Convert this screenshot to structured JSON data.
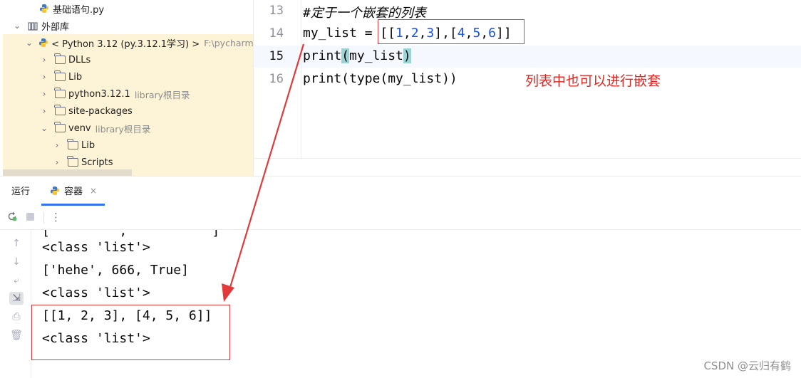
{
  "tree": {
    "items": [
      {
        "label": "基础语句.py",
        "hint": "",
        "path": "",
        "icon": "python-file-icon"
      },
      {
        "label": "外部库",
        "hint": "",
        "path": "",
        "icon": "library-icon"
      },
      {
        "label": "< Python 3.12 (py.3.12.1学习) >",
        "hint": "",
        "path": "F:\\pycharm-l",
        "icon": "python-sdk-icon"
      },
      {
        "label": "DLLs",
        "hint": "",
        "path": "",
        "icon": "folder-icon"
      },
      {
        "label": "Lib",
        "hint": "",
        "path": "",
        "icon": "folder-icon"
      },
      {
        "label": "python3.12.1",
        "hint": "library根目录",
        "path": "",
        "icon": "folder-icon"
      },
      {
        "label": "site-packages",
        "hint": "",
        "path": "",
        "icon": "folder-icon"
      },
      {
        "label": "venv",
        "hint": "library根目录",
        "path": "",
        "icon": "folder-icon"
      },
      {
        "label": "Lib",
        "hint": "",
        "path": "",
        "icon": "folder-icon"
      },
      {
        "label": "Scripts",
        "hint": "",
        "path": "",
        "icon": "folder-icon"
      }
    ]
  },
  "editor": {
    "lines": [
      {
        "number": "13",
        "code": "#定于一个嵌套的列表"
      },
      {
        "number": "14",
        "code_a": "my_list = [[",
        "n1": "1",
        "c1": ",",
        "n2": "2",
        "c2": ",",
        "n3": "3",
        "c3": "],[",
        "n4": "4",
        "c4": ",",
        "n5": "5",
        "c5": ",",
        "n6": "6",
        "c6": "]]"
      },
      {
        "number": "15",
        "p_open": "print",
        "lp": "(",
        "mid": "my_list",
        "rp": ")"
      },
      {
        "number": "16",
        "code": "print(type(my_list))"
      }
    ],
    "annotation": "列表中也可以进行嵌套"
  },
  "run": {
    "tab_run": "运行",
    "tab_active": "容器",
    "close_glyph": "×",
    "more_glyph": "⋮",
    "output": [
      "[         ,           ]",
      "<class 'list'>",
      "['hehe', 666, True]",
      "<class 'list'>",
      "[[1, 2, 3], [4, 5, 6]]",
      "<class 'list'>"
    ]
  },
  "watermark": "CSDN @云归有鹤",
  "colors": {
    "annotation_red": "#e6241f",
    "number_blue": "#1750eb",
    "tree_highlight": "#fdf3d6",
    "accent": "#3574f0"
  }
}
